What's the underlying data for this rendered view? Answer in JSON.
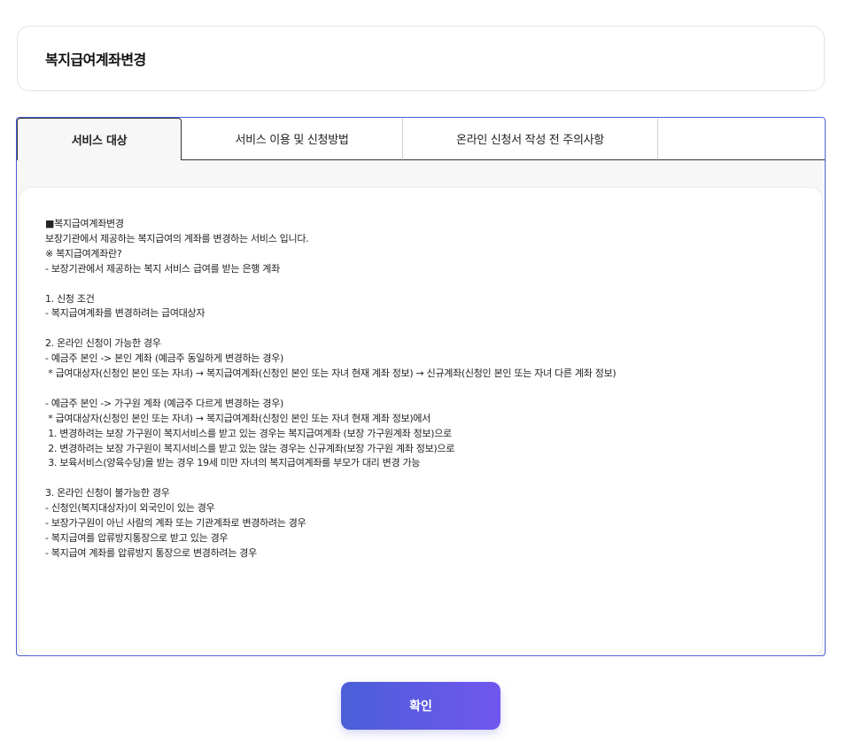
{
  "page": {
    "title": "복지급여계좌변경"
  },
  "tabs": [
    {
      "label": "서비스 대상",
      "active": true
    },
    {
      "label": "서비스 이용 및 신청방법",
      "active": false
    },
    {
      "label": "온라인 신청서 작성 전 주의사항",
      "active": false
    }
  ],
  "content": {
    "lines": [
      "■복지급여계좌변경",
      "보장기관에서 제공하는 복지급여의 계좌를 변경하는 서비스 입니다.",
      "※ 복지급여계좌란?",
      "- 보장기관에서 제공하는 복지 서비스 급여를 받는 은행 계좌",
      "",
      "1. 신청 조건",
      "- 복지급여계좌를 변경하려는 급여대상자",
      "",
      "2. 온라인 신청이 가능한 경우",
      "- 예금주 본인 -> 본인 계좌 (예금주 동일하게 변경하는 경우)",
      " * 급여대상자(신청인 본인 또는 자녀) → 복지급여계좌(신청인 본인 또는 자녀 현재 계좌 정보) → 신규계좌(신청인 본인 또는 자녀 다른 계좌 정보)",
      "",
      "- 예금주 본인 -> 가구원 계좌 (예금주 다르게 변경하는 경우)",
      " * 급여대상자(신청인 본인 또는 자녀) → 복지급여계좌(신청인 본인 또는 자녀 현재 계좌 정보)에서",
      " 1. 변경하려는 보장 가구원이 복지서비스를 받고 있는 경우는 복지급여계좌 (보장 가구원계좌 정보)으로",
      " 2. 변경하려는 보장 가구원이 복지서비스를 받고 있는 않는 경우는 신규계좌(보장 가구원 계좌 정보)으로",
      " 3. 보육서비스(양육수당)을 받는 경우 19세 미만 자녀의 복지급여계좌를 부모가 대리 변경 가능",
      "",
      "3. 온라인 신청이 불가능한 경우",
      "- 신청인(복지대상자)이 외국인이 있는 경우",
      "- 보장가구원이 아닌 사람의 계좌 또는 기관계좌로 변경하려는 경우",
      "- 복지급여를 압류방지통장으로 받고 있는 경우",
      "- 복지급여 계좌를 압류방지 통장으로 변경하려는 경우"
    ]
  },
  "buttons": {
    "confirm_label": "확인"
  },
  "colors": {
    "accent": "#4a5fd8",
    "accent_end": "#7156ee"
  }
}
